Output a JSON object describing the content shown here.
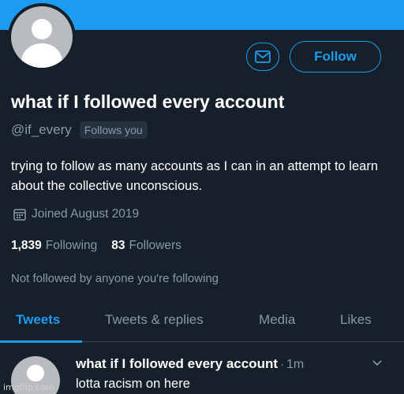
{
  "colors": {
    "background": "#15202b",
    "accent": "#1d9bf0",
    "muted": "#8899a6",
    "avatar": "#b8bcc0"
  },
  "header": {
    "message_icon": "envelope-icon",
    "follow_label": "Follow"
  },
  "profile": {
    "display_name": "what if I followed every account",
    "handle": "@if_every",
    "follows_you": "Follows you",
    "bio": "trying to follow as many accounts as I can in an attempt to learn about the collective unconscious.",
    "joined_icon": "calendar-icon",
    "joined": "Joined August 2019",
    "following_count": "1,839",
    "following_label": "Following",
    "followers_count": "83",
    "followers_label": "Followers",
    "not_followed": "Not followed by anyone you're following"
  },
  "tabs": [
    {
      "label": "Tweets",
      "active": true
    },
    {
      "label": "Tweets & replies",
      "active": false
    },
    {
      "label": "Media",
      "active": false
    },
    {
      "label": "Likes",
      "active": false
    }
  ],
  "tweet": {
    "author": "what if I followed every account",
    "separator": "·",
    "time": "1m",
    "text": "lotta racism on here",
    "menu_icon": "chevron-down-icon"
  },
  "watermark": "imgflip.com"
}
